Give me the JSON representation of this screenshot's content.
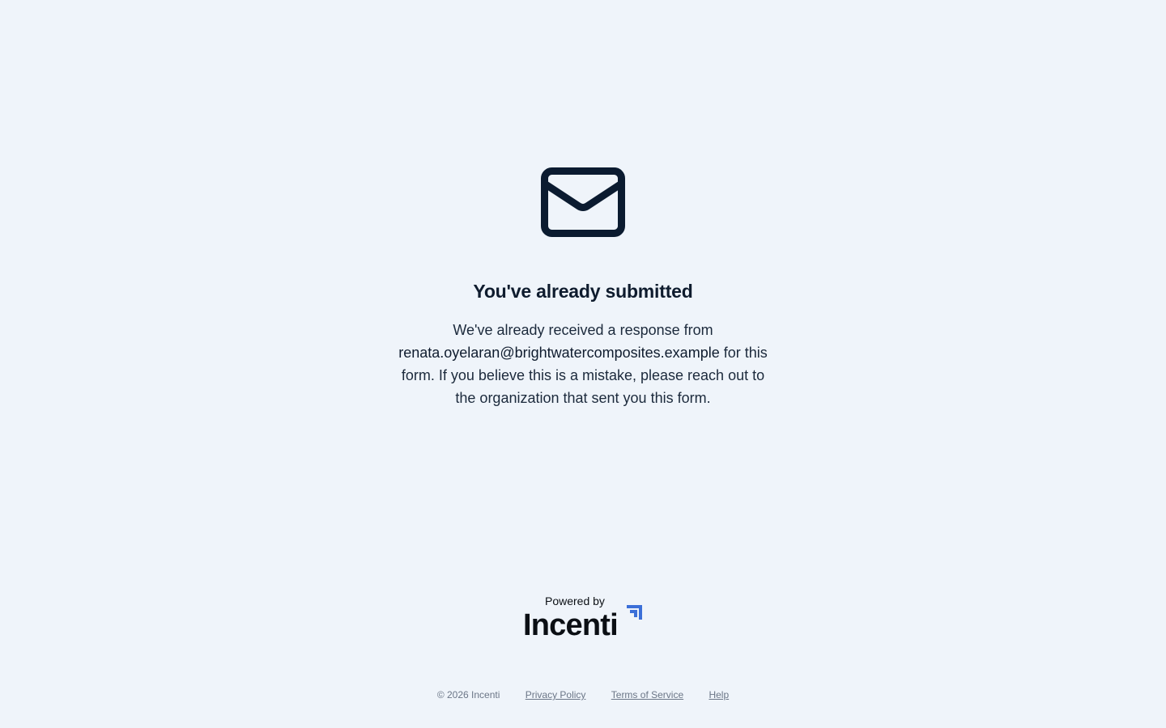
{
  "status": {
    "icon": "mail-icon",
    "title": "You've already submitted",
    "message_before": "We've already received a response from",
    "email": "renata.oyelaran@brightwatercomposites.example",
    "message_after": "for this form. If you believe this is a mistake, please reach out to the organization that sent you this form."
  },
  "branding": {
    "powered_by": "Powered by",
    "brand_name": "Incenti",
    "brand_icon": "incenti-logo-mark",
    "accent_color": "#3b6fd8"
  },
  "footer": {
    "copyright": "© 2026 Incenti",
    "links": [
      "Privacy Policy",
      "Terms of Service",
      "Help"
    ]
  },
  "colors": {
    "background": "#eff4fa",
    "text_primary": "#0f1c2e",
    "text_muted": "#6b7687"
  }
}
